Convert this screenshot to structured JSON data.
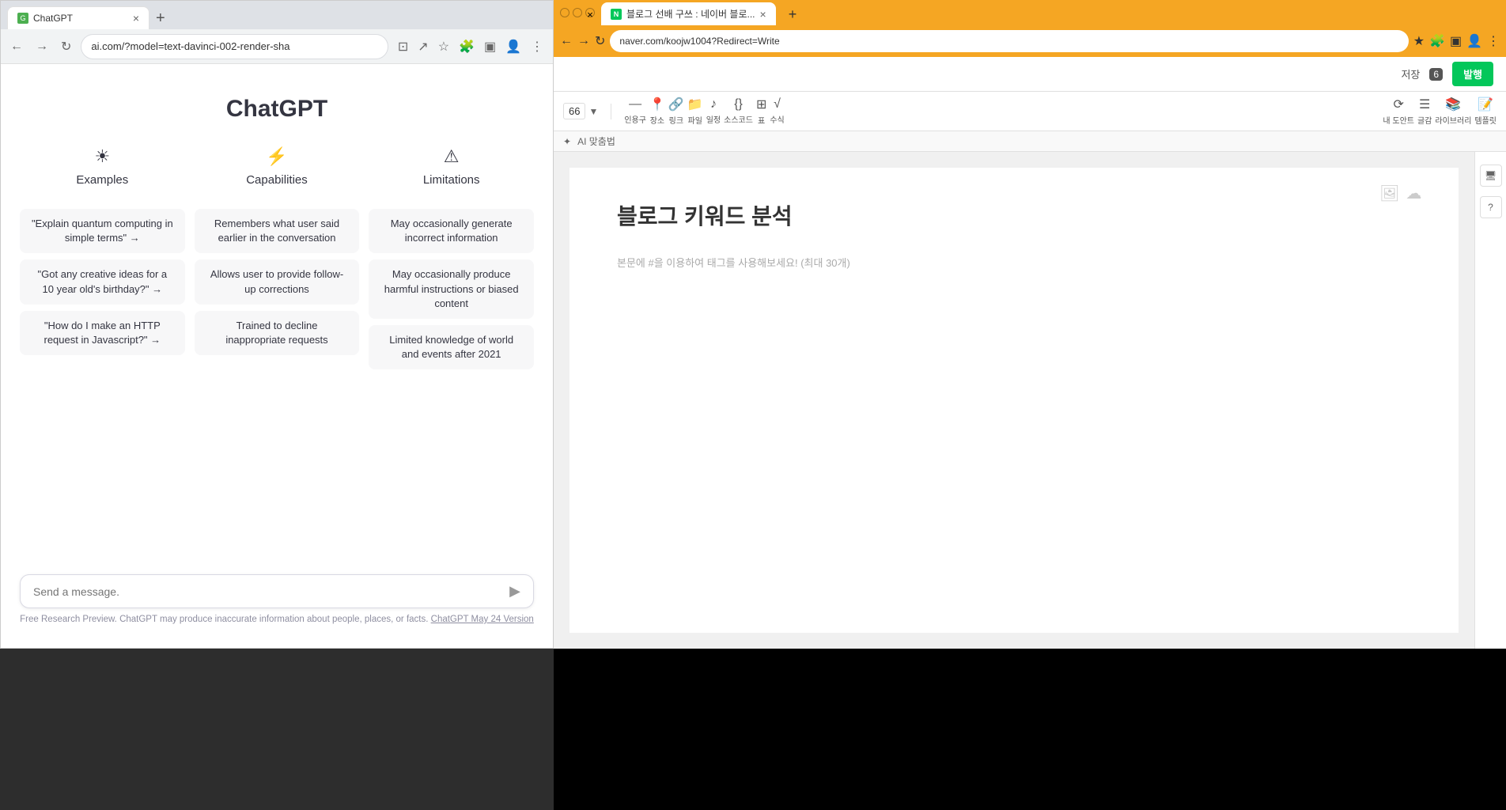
{
  "left_window": {
    "address": "ai.com/?model=text-davinci-002-render-sha",
    "tab_label": "ChatGPT",
    "chatgpt": {
      "title": "ChatGPT",
      "examples_header": "Examples",
      "capabilities_header": "Capabilities",
      "limitations_header": "Limitations",
      "examples_icon": "☀",
      "capabilities_icon": "⚡",
      "limitations_icon": "⚠",
      "examples": [
        "\"Explain quantum computing in simple terms\" →",
        "\"Got any creative ideas for a 10 year old's birthday?\" →",
        "\"How do I make an HTTP request in Javascript?\" →"
      ],
      "capabilities": [
        "Remembers what user said earlier in the conversation",
        "Allows user to provide follow-up corrections",
        "Trained to decline inappropriate requests"
      ],
      "limitations": [
        "May occasionally generate incorrect information",
        "May occasionally produce harmful instructions or biased content",
        "Limited knowledge of world and events after 2021"
      ],
      "input_placeholder": "Send a message.",
      "disclaimer": "Free Research Preview. ChatGPT may produce inaccurate information about people, places, or facts.",
      "disclaimer_link": "ChatGPT May 24 Version"
    }
  },
  "right_window": {
    "address": "naver.com/koojw1004?Redirect=Write",
    "tab_label": "블로그 선배 구쓰 : 네이버 블로...",
    "save_text": "저장",
    "save_count": "6",
    "publish_btn": "발행",
    "editor_title": "블로그 키워드 분석",
    "editor_placeholder": "본문에 #을 이용하여 태그를 사용해보세요! (최대 30개)",
    "magic_text": "AI 맞춤법",
    "toolbar": {
      "font_size": "66",
      "tools": [
        {
          "icon": "—",
          "label": "인용구"
        },
        {
          "icon": "📍",
          "label": "장소"
        },
        {
          "icon": "🔗",
          "label": "링크"
        },
        {
          "icon": "📁",
          "label": "파일"
        },
        {
          "icon": "♪",
          "label": "일정"
        },
        {
          "icon": "{}",
          "label": "소스코드"
        },
        {
          "icon": "⊞",
          "label": "표"
        },
        {
          "icon": "√",
          "label": "수식"
        }
      ],
      "right_tools": [
        {
          "icon": "⟳",
          "label": "내 도안트"
        },
        {
          "icon": "☰",
          "label": "글감"
        },
        {
          "icon": "📚",
          "label": "라이브러리"
        },
        {
          "icon": "📝",
          "label": "템플릿"
        }
      ]
    }
  }
}
